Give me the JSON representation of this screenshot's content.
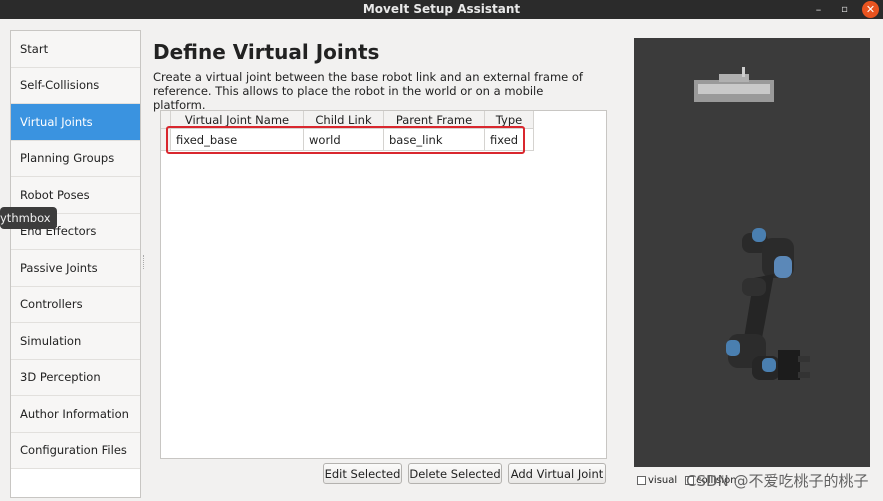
{
  "window": {
    "title": "MoveIt Setup Assistant",
    "minimize": "–",
    "maximize": "▫",
    "close": "✕"
  },
  "sidebar": {
    "items": [
      {
        "label": "Start"
      },
      {
        "label": "Self-Collisions"
      },
      {
        "label": "Virtual Joints",
        "active": true
      },
      {
        "label": "Planning Groups"
      },
      {
        "label": "Robot Poses"
      },
      {
        "label": "End Effectors"
      },
      {
        "label": "Passive Joints"
      },
      {
        "label": "Controllers"
      },
      {
        "label": "Simulation"
      },
      {
        "label": "3D Perception"
      },
      {
        "label": "Author Information"
      },
      {
        "label": "Configuration Files"
      }
    ]
  },
  "tooltip": {
    "text": "ythmbox"
  },
  "main": {
    "title": "Define Virtual Joints",
    "description": "Create a virtual joint between the base robot link and an external frame of reference. This allows to place the robot in the world or on a mobile platform.",
    "table": {
      "headers": [
        "Virtual Joint Name",
        "Child Link",
        "Parent Frame",
        "Type"
      ],
      "rows": [
        [
          "fixed_base",
          "world",
          "base_link",
          "fixed"
        ]
      ]
    },
    "buttons": {
      "edit": "Edit Selected",
      "delete": "Delete Selected",
      "add": "Add Virtual Joint"
    }
  },
  "viewer": {
    "visual_label": "visual",
    "collision_label": "collision"
  },
  "watermark": "CSDN @不爱吃桃子的桃子",
  "colors": {
    "accent": "#3a93e0",
    "highlight": "#d9272e",
    "close": "#e95420",
    "viewer_bg": "#3b3b3b"
  }
}
